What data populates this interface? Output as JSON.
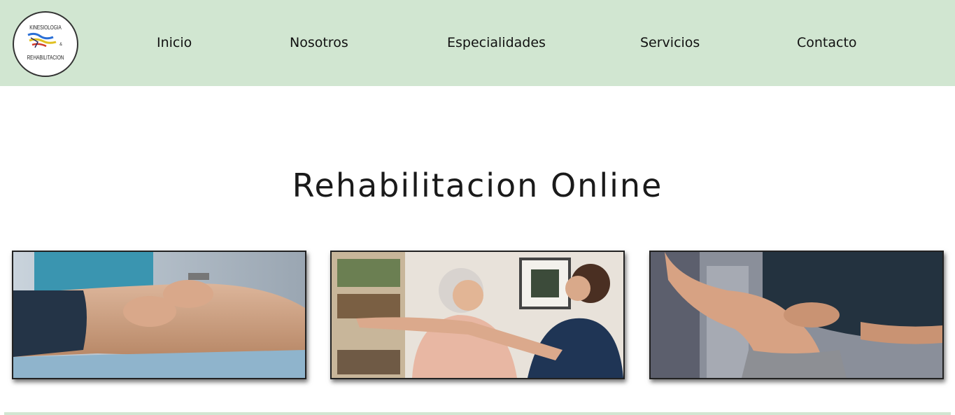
{
  "logo": {
    "top_text": "KINESIOLOGIA",
    "amp": "&",
    "bottom_text": "REHABILITACION"
  },
  "nav": {
    "items": [
      {
        "label": "Inicio"
      },
      {
        "label": "Nosotros"
      },
      {
        "label": "Especialidades"
      },
      {
        "label": "Servicios"
      },
      {
        "label": "Contacto"
      }
    ]
  },
  "main": {
    "title": "Rehabilitacion Online"
  },
  "colors": {
    "header_bg": "#d1e6d1",
    "footer_line": "#d1e6d1",
    "text": "#111111"
  }
}
